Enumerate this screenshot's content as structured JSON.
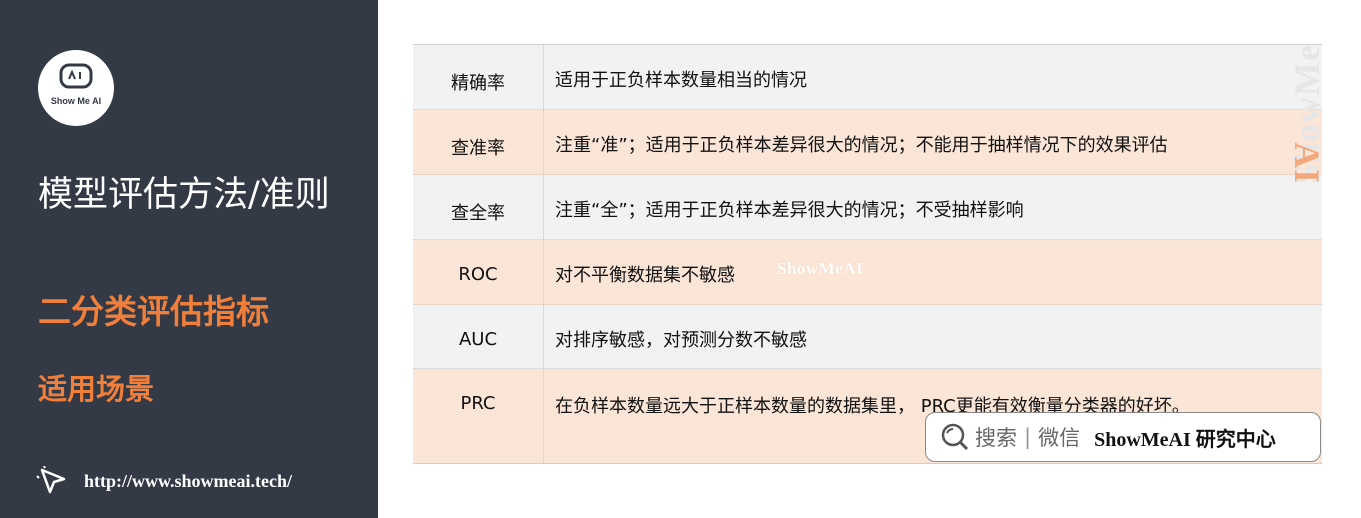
{
  "sidebar": {
    "logo_text": "Show Me AI",
    "title": "模型评估方法/准则",
    "section": "二分类评估指标",
    "subsection": "适用场景",
    "url": "http://www.showmeai.tech/"
  },
  "table": {
    "rows": [
      {
        "name": "精确率",
        "desc": "适用于正负样本数量相当的情况"
      },
      {
        "name": "查准率",
        "desc": "注重“准”；适用于正负样本差异很大的情况；不能用于抽样情况下的效果评估"
      },
      {
        "name": "查全率",
        "desc": "注重“全”；适用于正负样本差异很大的情况；不受抽样影响"
      },
      {
        "name": "ROC",
        "desc": "对不平衡数据集不敏感"
      },
      {
        "name": "AUC",
        "desc": "对排序敏感，对预测分数不敏感"
      },
      {
        "name": "PRC",
        "desc": "在负样本数量远大于正样本数量的数据集里， PRC更能有效衡量分类器的好坏。"
      }
    ]
  },
  "watermark": {
    "inline": "ShowMeAI",
    "vertical_main": "ShowMe",
    "vertical_accent": "AI"
  },
  "badge": {
    "search_label": "搜索",
    "separator": "|",
    "wechat_label": "微信",
    "brand": "ShowMeAI 研究中心"
  },
  "colors": {
    "sidebar_bg": "#333a45",
    "accent": "#f07f3c",
    "row_odd": "#f2f2f2",
    "row_even": "#fbe5d6"
  }
}
